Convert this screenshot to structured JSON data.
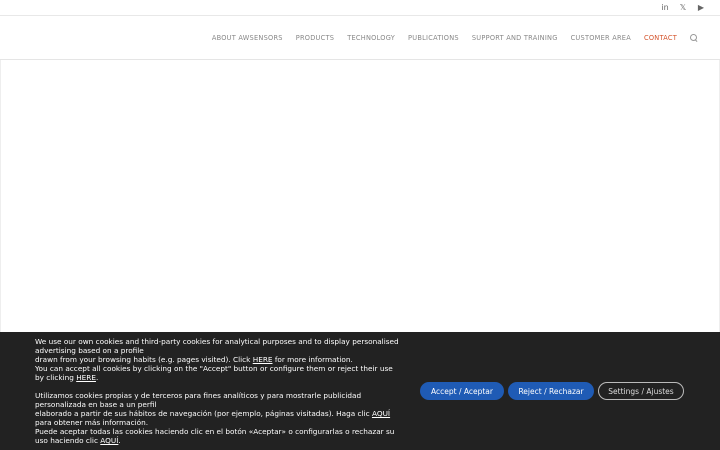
{
  "social": {
    "linkedin": "in",
    "x": "𝕏",
    "youtube": "▶"
  },
  "nav": {
    "items": [
      {
        "label": "ABOUT AWSENSORS"
      },
      {
        "label": "PRODUCTS"
      },
      {
        "label": "TECHNOLOGY"
      },
      {
        "label": "PUBLICATIONS"
      },
      {
        "label": "SUPPORT AND TRAINING"
      },
      {
        "label": "CUSTOMER AREA"
      },
      {
        "label": "CONTACT"
      }
    ],
    "active_color": "#d4522a"
  },
  "cookie": {
    "en": {
      "line1": "We use our own cookies and third-party cookies for analytical purposes and to display personalised advertising based on a profile",
      "line2a": "drawn from your browsing habits (e.g. pages visited). Click ",
      "link1": "HERE",
      "line2b": " for more information.",
      "line3": "You can accept all cookies by clicking on the \"Accept\" button or configure them or reject their use by clicking ",
      "link2": "HERE",
      "line3end": "."
    },
    "es": {
      "line1": "Utilizamos cookies propias y de terceros para fines analíticos y para mostrarle publicidad personalizada en base a un perfil",
      "line2a": "elaborado a partir de sus hábitos de navegación (por ejemplo, páginas visitadas). Haga clic ",
      "link1": "AQUÍ",
      "line2b": " para obtener más información.",
      "line3": "Puede aceptar todas las cookies haciendo clic en el botón «Aceptar» o configurarlas o rechazar su uso haciendo clic ",
      "link2": "AQUÍ",
      "line3end": "."
    },
    "buttons": {
      "accept": "Accept / Aceptar",
      "reject": "Reject / Rechazar",
      "settings": "Settings / Ajustes"
    },
    "accent": "#1f5bb5",
    "background": "#222222"
  }
}
